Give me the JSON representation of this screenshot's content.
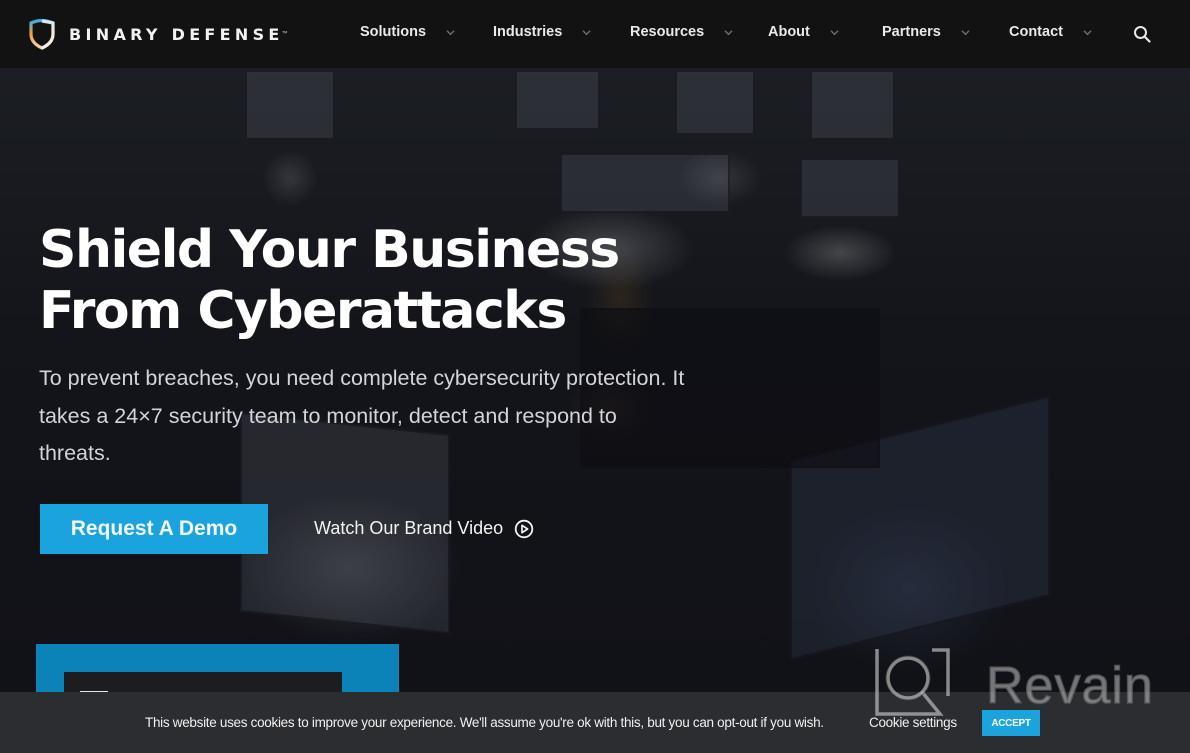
{
  "brand": {
    "name": "BINARY DEFENSE",
    "trademark": "™",
    "accent_color": "#1aa3dd"
  },
  "nav": {
    "items": [
      {
        "label": "Solutions",
        "icon": "chevron-down-icon"
      },
      {
        "label": "Industries",
        "icon": "chevron-down-icon"
      },
      {
        "label": "Resources",
        "icon": "chevron-down-icon"
      },
      {
        "label": "About",
        "icon": "chevron-down-icon"
      },
      {
        "label": "Partners",
        "icon": "chevron-down-icon"
      },
      {
        "label": "Contact",
        "icon": "chevron-down-icon"
      }
    ],
    "search_icon": "search-icon"
  },
  "hero": {
    "headline_line1": "Shield Your Business",
    "headline_line2": "From Cyberattacks",
    "subtext": "To prevent breaches, you need complete cybersecurity protection. It takes a 24×7 security team to monitor, detect and respond to threats.",
    "primary_button": "Request A Demo",
    "video_link": "Watch Our Brand Video",
    "video_icon": "play-circle-icon"
  },
  "cookie_bar": {
    "message": "This website uses cookies to improve your experience. We'll assume you're ok with this, but you can opt-out if you wish.",
    "settings_link": "Cookie settings",
    "accept_button": "ACCEPT"
  },
  "watermark": {
    "text": "Revain"
  }
}
